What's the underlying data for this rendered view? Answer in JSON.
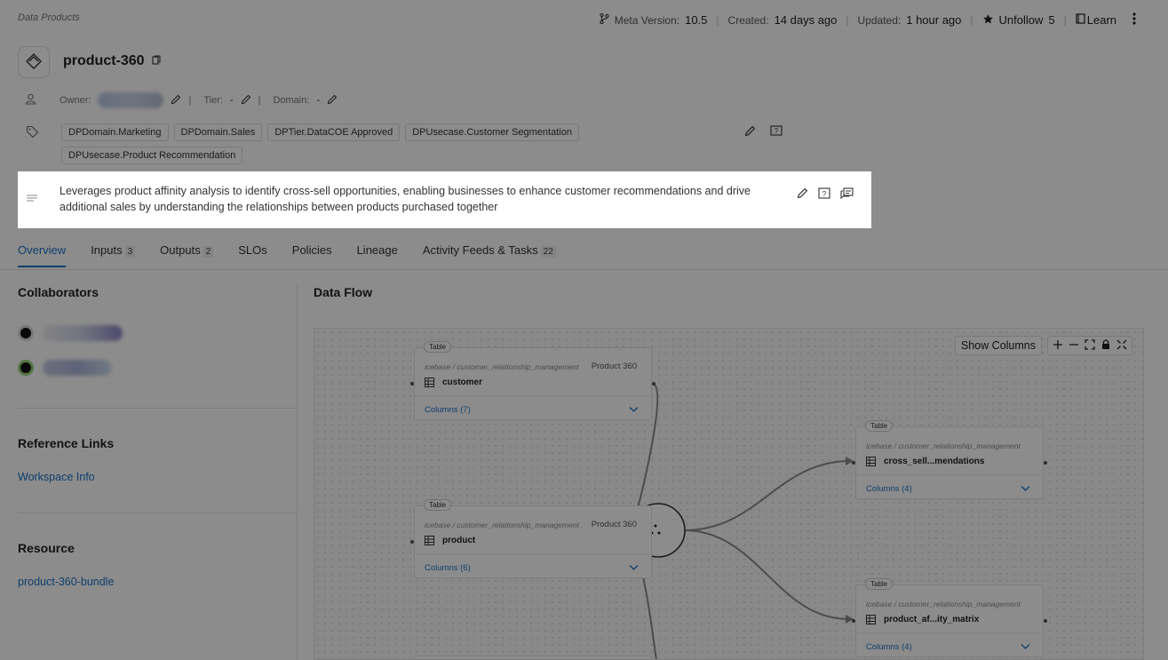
{
  "breadcrumb": "Data Products",
  "meta": {
    "meta_version_label": "Meta Version:",
    "meta_version_value": "10.5",
    "created_label": "Created:",
    "created_value": "14 days ago",
    "updated_label": "Updated:",
    "updated_value": "1 hour ago",
    "unfollow_label": "Unfollow",
    "follow_count": "5",
    "learn_label": "Learn"
  },
  "product": {
    "title": "product-360",
    "owner_label": "Owner:",
    "tier_label": "Tier:",
    "tier_value": "-",
    "domain_label": "Domain:",
    "domain_value": "-",
    "sep": "|"
  },
  "tags": [
    "DPDomain.Marketing",
    "DPDomain.Sales",
    "DPTier.DataCOE Approved",
    "DPUsecase.Customer Segmentation",
    "DPUsecase.Product Recommendation"
  ],
  "description": "Leverages product affinity analysis to identify cross-sell opportunities, enabling businesses to enhance customer recommendations and drive additional sales by understanding the relationships between products purchased together",
  "tabs": [
    {
      "label": "Overview",
      "count": ""
    },
    {
      "label": "Inputs",
      "count": "3"
    },
    {
      "label": "Outputs",
      "count": "2"
    },
    {
      "label": "SLOs",
      "count": ""
    },
    {
      "label": "Policies",
      "count": ""
    },
    {
      "label": "Lineage",
      "count": ""
    },
    {
      "label": "Activity Feeds & Tasks",
      "count": "22"
    }
  ],
  "left": {
    "collaborators_title": "Collaborators",
    "reference_title": "Reference Links",
    "reference_link": "Workspace Info",
    "resource_title": "Resource",
    "resource_link": "product-360-bundle"
  },
  "dataflow": {
    "title": "Data Flow",
    "show_columns": "Show Columns",
    "nodes": [
      {
        "pill": "Table",
        "path": "icebase / customer_relationship_management",
        "product": "Product 360",
        "name": "customer",
        "columns": "Columns (7)"
      },
      {
        "pill": "Table",
        "path": "icebase / customer_relationship_management",
        "product": "Product 360",
        "name": "product",
        "columns": "Columns (6)"
      },
      {
        "pill": "Table",
        "path": "icebase / customer_relationship_management",
        "product": "",
        "name": "cross_sell...mendations",
        "columns": "Columns (4)"
      },
      {
        "pill": "Table",
        "path": "icebase / customer_relationship_management",
        "product": "",
        "name": "product_af...ity_matrix",
        "columns": "Columns (4)"
      }
    ]
  },
  "colors": {
    "accent": "#1a73c8",
    "overlay": "rgba(0,0,0,0.45)"
  }
}
